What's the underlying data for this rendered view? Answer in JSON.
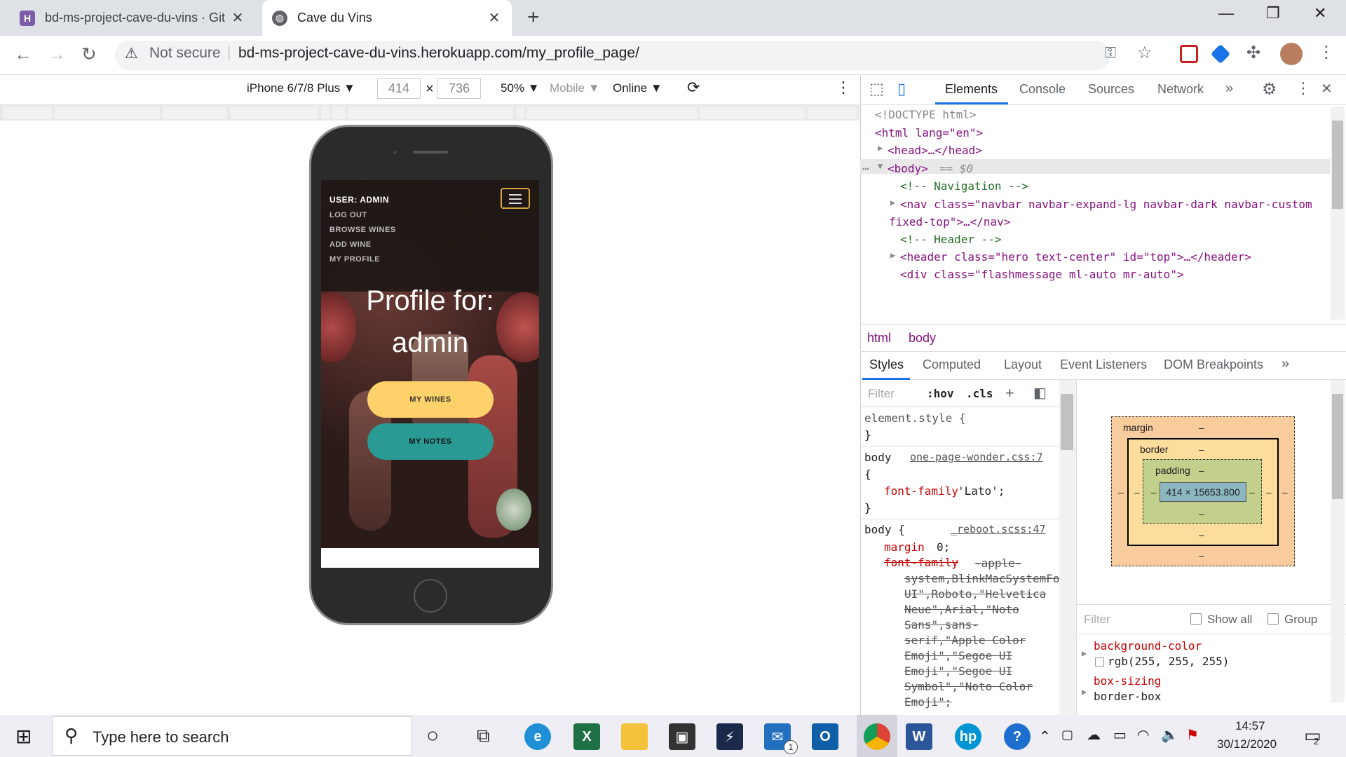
{
  "tabs": [
    {
      "title": "bd-ms-project-cave-du-vins · Git",
      "favicon": "heroku-icon"
    },
    {
      "title": "Cave du Vins",
      "favicon": "globe-icon"
    }
  ],
  "address": {
    "security": "Not secure",
    "url": "bd-ms-project-cave-du-vins.herokuapp.com/my_profile_page/"
  },
  "device_toolbar": {
    "device": "iPhone 6/7/8 Plus",
    "width": "414",
    "height": "736",
    "zoom": "50%",
    "throttle_type": "Mobile",
    "network": "Online"
  },
  "site": {
    "user_label": "USER: ADMIN",
    "nav": [
      "LOG OUT",
      "BROWSE WINES",
      "ADD WINE",
      "MY PROFILE"
    ],
    "hero_line1": "Profile for:",
    "hero_line2": "admin",
    "btn_wines": "MY WINES",
    "btn_notes": "MY NOTES",
    "colors": {
      "wines": "#fed16a",
      "notes": "#2a9a94"
    }
  },
  "devtools": {
    "tabs": [
      "Elements",
      "Console",
      "Sources",
      "Network"
    ],
    "dom": {
      "doctype": "<!DOCTYPE html>",
      "html_open": "<html lang=\"en\">",
      "head": "<head>…</head>",
      "body": "<body>",
      "body_sel": "== $0",
      "cmt_nav": "<!-- Navigation -->",
      "nav_line1": "<nav class=\"navbar navbar-expand-lg navbar-dark navbar-custom",
      "nav_line2": "fixed-top\">…</nav>",
      "cmt_header": "<!-- Header -->",
      "header_line": "<header class=\"hero text-center\" id=\"top\">…</header>",
      "div_line": "<div class=\"flashmessage ml-auto mr-auto\">"
    },
    "breadcrumb": [
      "html",
      "body"
    ],
    "subtabs": [
      "Styles",
      "Computed",
      "Layout",
      "Event Listeners",
      "DOM Breakpoints"
    ],
    "filter_placeholder": "Filter",
    "hov": ":hov",
    "cls": ".cls",
    "rules": {
      "element_style": "element.style {",
      "close": "}",
      "body_sel": "body",
      "body_brace": "{",
      "body_src1": "one-page-wonder.css:7",
      "font_decl_name": "font-family",
      "font_decl_val": "'Lato';",
      "body2_sel": "body {",
      "body_src2": "_reboot.scss:47",
      "margin_name": "margin",
      "margin_val": "0;",
      "ff_name": "font-family",
      "ff_val": [
        "-apple-",
        "system,BlinkMacSystemFo",
        "UI\",Roboto,\"Helvetica",
        "Neue\",Arial,\"Noto",
        "Sans\",sans-",
        "serif,\"Apple Color",
        "Emoji\",\"Segoe UI",
        "Emoji\",\"Segoe UI",
        "Symbol\",\"Noto Color",
        "Emoji\";"
      ]
    },
    "boxmodel": {
      "margin": "margin",
      "border": "border",
      "padding": "padding",
      "dash": "–",
      "content": "414 × 15653.800"
    },
    "computed": {
      "filter": "Filter",
      "show_all": "Show all",
      "group": "Group",
      "bg_name": "background-color",
      "bg_val": "rgb(255, 255, 255)",
      "bs_name": "box-sizing",
      "bs_val": "border-box"
    }
  },
  "taskbar": {
    "search_placeholder": "Type here to search",
    "time": "14:57",
    "date": "30/12/2020",
    "notif_count": "2",
    "mail_badge": "1"
  }
}
